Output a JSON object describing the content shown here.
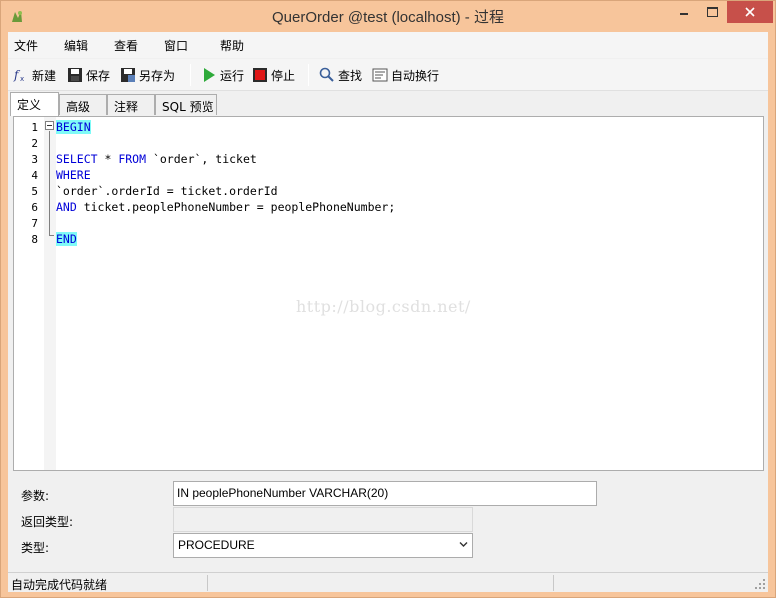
{
  "window": {
    "title": "QuerOrder @test (localhost) - 过程"
  },
  "menu": {
    "items": [
      "文件",
      "编辑",
      "查看",
      "窗口",
      "帮助"
    ]
  },
  "toolbar": {
    "new_label": "新建",
    "save_label": "保存",
    "save_as_label": "另存为",
    "run_label": "运行",
    "stop_label": "停止",
    "find_label": "查找",
    "wrap_label": "自动换行"
  },
  "tabs": [
    "定义",
    "高级",
    "注释",
    "SQL 预览"
  ],
  "editor": {
    "line_numbers": [
      "1",
      "2",
      "3",
      "4",
      "5",
      "6",
      "7",
      "8"
    ],
    "lines": {
      "l1": "BEGIN",
      "l3_kw1": "SELECT",
      "l3_rest": " * ",
      "l3_kw2": "FROM",
      "l3_tail": " `order`, ticket",
      "l4": "WHERE",
      "l5": "`order`.orderId = ticket.orderId",
      "l6_kw": "AND",
      "l6_rest": " ticket.peoplePhoneNumber = peoplePhoneNumber;",
      "l8": "END"
    },
    "watermark": "http://blog.csdn.net/"
  },
  "properties": {
    "params_label": "参数:",
    "params_value": "IN peoplePhoneNumber VARCHAR(20)",
    "return_type_label": "返回类型:",
    "return_type_value": "",
    "type_label": "类型:",
    "type_value": "PROCEDURE"
  },
  "status": {
    "text": "自动完成代码就绪"
  }
}
